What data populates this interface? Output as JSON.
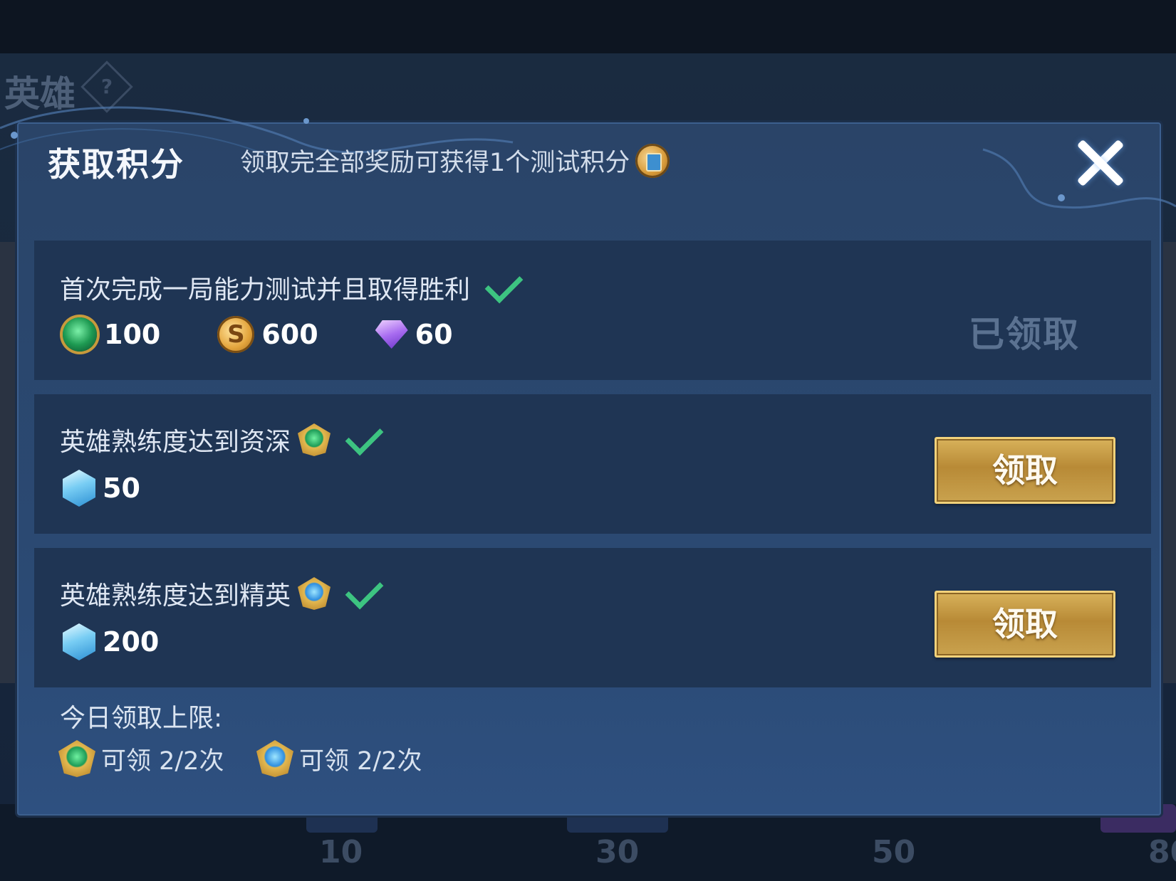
{
  "background": {
    "section_title": "英雄",
    "help_glyph": "?",
    "level_markers": [
      "10",
      "30",
      "50",
      "80"
    ]
  },
  "dialog": {
    "title": "获取积分",
    "subtitle": "领取完全部奖励可获得1个测试积分",
    "subtitle_icon": "test-point-coin-icon"
  },
  "tasks": [
    {
      "name": "首次完成一局能力测试并且取得胜利",
      "completed": true,
      "rewards": [
        {
          "icon": "emerald-orb-icon",
          "value": "100"
        },
        {
          "icon": "gold-coin-icon",
          "value": "600"
        },
        {
          "icon": "purple-diamond-icon",
          "value": "60"
        }
      ],
      "status_label": "已领取"
    },
    {
      "name": "英雄熟练度达到资深",
      "badge_icon": "green-mastery-badge-icon",
      "completed": true,
      "rewards": [
        {
          "icon": "blue-crystal-icon",
          "value": "50"
        }
      ],
      "button_label": "领取"
    },
    {
      "name": "英雄熟练度达到精英",
      "badge_icon": "blue-mastery-badge-icon",
      "completed": true,
      "rewards": [
        {
          "icon": "blue-crystal-icon",
          "value": "200"
        }
      ],
      "button_label": "领取"
    }
  ],
  "daily_limit": {
    "title": "今日领取上限:",
    "items": [
      {
        "icon": "green-mastery-badge-icon",
        "text": "可领 2/2次"
      },
      {
        "icon": "blue-mastery-badge-icon",
        "text": "可领 2/2次"
      }
    ]
  },
  "colors": {
    "dialog_bg": "#2a4468",
    "row_bg": "#1f3554",
    "check_green": "#3dc481",
    "button_gold": "#c9a24e"
  }
}
